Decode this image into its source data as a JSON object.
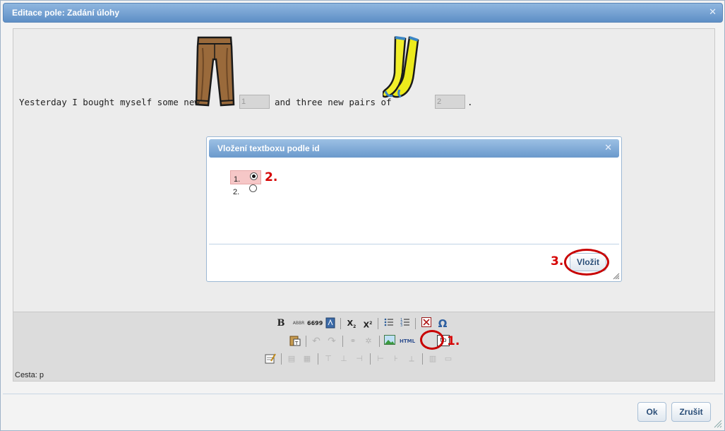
{
  "window": {
    "title": "Editace pole: Zadání úlohy"
  },
  "editor": {
    "sentence": {
      "part1": "Yesterday I bought myself some new",
      "field1": "1",
      "part2": "and three new pairs of",
      "field2": "2",
      "part3": "."
    },
    "toolbar": {
      "row1": [
        "bold-icon",
        "abbr-icon",
        "quote-icon",
        "spellcheck-icon",
        "subscript-icon",
        "superscript-icon",
        "bullet-list-icon",
        "numbered-list-icon",
        "remove-format-icon",
        "special-char-icon"
      ],
      "row1_labels": {
        "bold": "B",
        "abbr": "ABBR",
        "quote": "6699",
        "subscript": "X",
        "superscript": "X",
        "omega": "Ω"
      },
      "row2_labels": {
        "html": "HTML",
        "textbox": "tb"
      },
      "path_label": "Cesta: p"
    }
  },
  "dialog": {
    "title": "Vložení textboxu podle id",
    "options": [
      {
        "label": "1.",
        "selected": true
      },
      {
        "label": "2.",
        "selected": false
      }
    ],
    "insert_button": "Vložit"
  },
  "annotations": {
    "step1": "1.",
    "step2": "2.",
    "step3": "3."
  },
  "footer": {
    "ok_button": "Ok",
    "cancel_button": "Zrušit"
  },
  "colors": {
    "titlebar": "#6f9dd0",
    "annotation": "#d60000",
    "selected_row": "#f6c7c7"
  }
}
